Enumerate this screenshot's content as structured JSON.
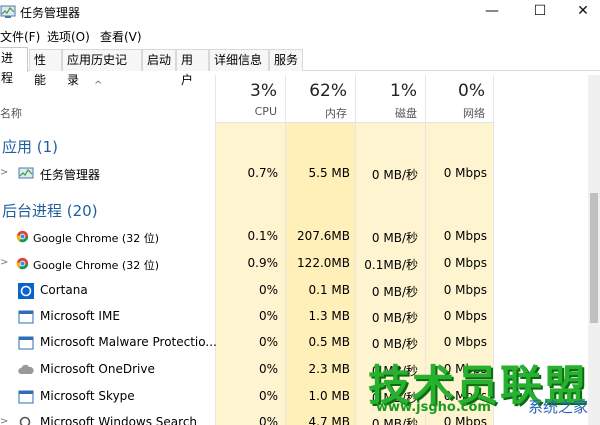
{
  "window": {
    "title": "任务管理器",
    "min": "—",
    "max": "☐",
    "close": "✕"
  },
  "menu": [
    "文件(F)",
    "选项(O)",
    "查看(V)"
  ],
  "tabs": [
    "进程",
    "性能",
    "应用历史记录",
    "启动",
    "用户",
    "详细信息",
    "服务"
  ],
  "columns": {
    "name": "名称",
    "cpu": {
      "pct": "3%",
      "label": "CPU"
    },
    "memory": {
      "pct": "62%",
      "label": "内存"
    },
    "disk": {
      "pct": "1%",
      "label": "磁盘"
    },
    "network": {
      "pct": "0%",
      "label": "网络"
    }
  },
  "groups": {
    "apps": "应用 (1)",
    "background": "后台进程 (20)"
  },
  "rows": [
    {
      "name": "任务管理器",
      "cpu": "0.7%",
      "mem": "5.5 MB",
      "disk": "0 MB/秒",
      "net": "0 Mbps"
    },
    {
      "name": "Google Chrome (32 位)",
      "cpu": "0.1%",
      "mem": "207.6MB",
      "disk": "0 MB/秒",
      "net": "0 Mbps"
    },
    {
      "name": "Google Chrome (32 位)",
      "cpu": "0.9%",
      "mem": "122.0MB",
      "disk": "0.1MB/秒",
      "net": "0 Mbps"
    },
    {
      "name": "Cortana",
      "cpu": "0%",
      "mem": "0.1 MB",
      "disk": "0 MB/秒",
      "net": "0 Mbps"
    },
    {
      "name": "Microsoft IME",
      "cpu": "0%",
      "mem": "1.3 MB",
      "disk": "0 MB/秒",
      "net": "0 Mbps"
    },
    {
      "name": "Microsoft Malware Protectio...",
      "cpu": "0%",
      "mem": "0.5 MB",
      "disk": "0 MB/秒",
      "net": "0 Mbps"
    },
    {
      "name": "Microsoft OneDrive",
      "cpu": "0%",
      "mem": "2.3 MB",
      "disk": "0 MB/秒",
      "net": "0 Mbps"
    },
    {
      "name": "Microsoft Skype",
      "cpu": "0%",
      "mem": "1.0 MB",
      "disk": "0 MB/秒",
      "net": "0 Mbps"
    },
    {
      "name": "Microsoft Windows Search",
      "cpu": "0%",
      "mem": "4.7 MB",
      "disk": "0 MB/秒",
      "net": "0 Mbps"
    }
  ],
  "watermark": {
    "main": "技术员联盟",
    "url": "www.jsgho.com",
    "sub": "系统之家"
  },
  "colors": {
    "heat_light": "#fff5d6",
    "heat_mid": "#ffefb8",
    "group_blue": "#1f5f9e"
  }
}
